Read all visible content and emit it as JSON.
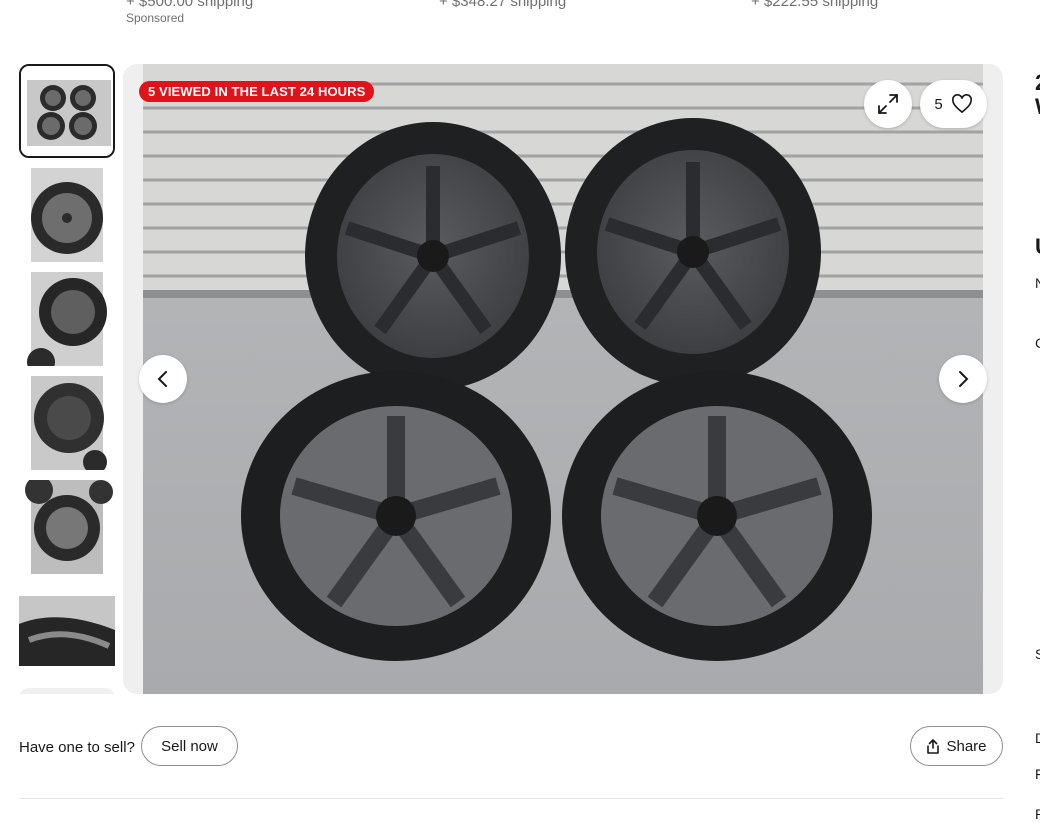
{
  "shipping_strip": {
    "items": [
      "+ $500.00 shipping",
      "+ $348.27 shipping",
      "+ $222.55 shipping"
    ],
    "sponsored": "Sponsored"
  },
  "gallery": {
    "badge": "5 VIEWED IN THE LAST 24 HOURS",
    "watch_count": "5",
    "thumbnails_count": 7,
    "selected_thumbnail": 1
  },
  "sell": {
    "prompt": "Have one to sell?",
    "button": "Sell now"
  },
  "share": {
    "label": "Share"
  },
  "right_column": {
    "letters": [
      "2",
      "W",
      "U",
      "N",
      "C",
      "S",
      "D",
      "F",
      "P"
    ]
  },
  "icons": [
    "expand-icon",
    "heart-icon",
    "chevron-left-icon",
    "chevron-right-icon",
    "share-icon"
  ]
}
